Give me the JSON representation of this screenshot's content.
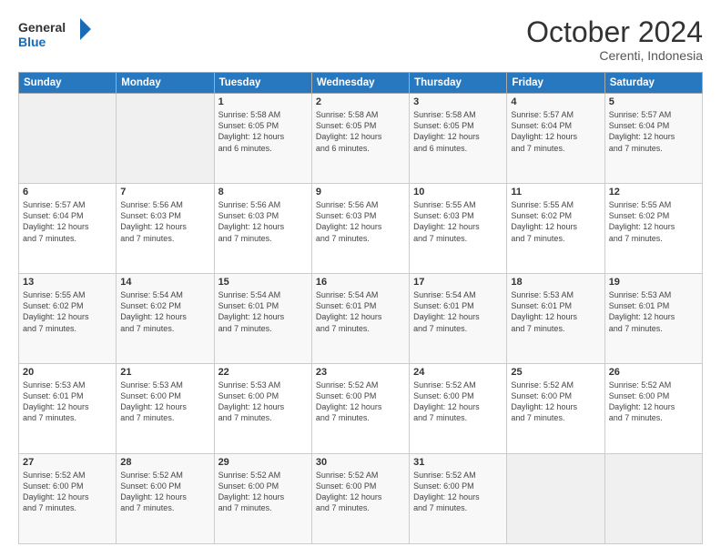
{
  "logo": {
    "line1": "General",
    "line2": "Blue"
  },
  "title": "October 2024",
  "subtitle": "Cerenti, Indonesia",
  "header_days": [
    "Sunday",
    "Monday",
    "Tuesday",
    "Wednesday",
    "Thursday",
    "Friday",
    "Saturday"
  ],
  "weeks": [
    [
      {
        "day": "",
        "info": ""
      },
      {
        "day": "",
        "info": ""
      },
      {
        "day": "1",
        "info": "Sunrise: 5:58 AM\nSunset: 6:05 PM\nDaylight: 12 hours\nand 6 minutes."
      },
      {
        "day": "2",
        "info": "Sunrise: 5:58 AM\nSunset: 6:05 PM\nDaylight: 12 hours\nand 6 minutes."
      },
      {
        "day": "3",
        "info": "Sunrise: 5:58 AM\nSunset: 6:05 PM\nDaylight: 12 hours\nand 6 minutes."
      },
      {
        "day": "4",
        "info": "Sunrise: 5:57 AM\nSunset: 6:04 PM\nDaylight: 12 hours\nand 7 minutes."
      },
      {
        "day": "5",
        "info": "Sunrise: 5:57 AM\nSunset: 6:04 PM\nDaylight: 12 hours\nand 7 minutes."
      }
    ],
    [
      {
        "day": "6",
        "info": "Sunrise: 5:57 AM\nSunset: 6:04 PM\nDaylight: 12 hours\nand 7 minutes."
      },
      {
        "day": "7",
        "info": "Sunrise: 5:56 AM\nSunset: 6:03 PM\nDaylight: 12 hours\nand 7 minutes."
      },
      {
        "day": "8",
        "info": "Sunrise: 5:56 AM\nSunset: 6:03 PM\nDaylight: 12 hours\nand 7 minutes."
      },
      {
        "day": "9",
        "info": "Sunrise: 5:56 AM\nSunset: 6:03 PM\nDaylight: 12 hours\nand 7 minutes."
      },
      {
        "day": "10",
        "info": "Sunrise: 5:55 AM\nSunset: 6:03 PM\nDaylight: 12 hours\nand 7 minutes."
      },
      {
        "day": "11",
        "info": "Sunrise: 5:55 AM\nSunset: 6:02 PM\nDaylight: 12 hours\nand 7 minutes."
      },
      {
        "day": "12",
        "info": "Sunrise: 5:55 AM\nSunset: 6:02 PM\nDaylight: 12 hours\nand 7 minutes."
      }
    ],
    [
      {
        "day": "13",
        "info": "Sunrise: 5:55 AM\nSunset: 6:02 PM\nDaylight: 12 hours\nand 7 minutes."
      },
      {
        "day": "14",
        "info": "Sunrise: 5:54 AM\nSunset: 6:02 PM\nDaylight: 12 hours\nand 7 minutes."
      },
      {
        "day": "15",
        "info": "Sunrise: 5:54 AM\nSunset: 6:01 PM\nDaylight: 12 hours\nand 7 minutes."
      },
      {
        "day": "16",
        "info": "Sunrise: 5:54 AM\nSunset: 6:01 PM\nDaylight: 12 hours\nand 7 minutes."
      },
      {
        "day": "17",
        "info": "Sunrise: 5:54 AM\nSunset: 6:01 PM\nDaylight: 12 hours\nand 7 minutes."
      },
      {
        "day": "18",
        "info": "Sunrise: 5:53 AM\nSunset: 6:01 PM\nDaylight: 12 hours\nand 7 minutes."
      },
      {
        "day": "19",
        "info": "Sunrise: 5:53 AM\nSunset: 6:01 PM\nDaylight: 12 hours\nand 7 minutes."
      }
    ],
    [
      {
        "day": "20",
        "info": "Sunrise: 5:53 AM\nSunset: 6:01 PM\nDaylight: 12 hours\nand 7 minutes."
      },
      {
        "day": "21",
        "info": "Sunrise: 5:53 AM\nSunset: 6:00 PM\nDaylight: 12 hours\nand 7 minutes."
      },
      {
        "day": "22",
        "info": "Sunrise: 5:53 AM\nSunset: 6:00 PM\nDaylight: 12 hours\nand 7 minutes."
      },
      {
        "day": "23",
        "info": "Sunrise: 5:52 AM\nSunset: 6:00 PM\nDaylight: 12 hours\nand 7 minutes."
      },
      {
        "day": "24",
        "info": "Sunrise: 5:52 AM\nSunset: 6:00 PM\nDaylight: 12 hours\nand 7 minutes."
      },
      {
        "day": "25",
        "info": "Sunrise: 5:52 AM\nSunset: 6:00 PM\nDaylight: 12 hours\nand 7 minutes."
      },
      {
        "day": "26",
        "info": "Sunrise: 5:52 AM\nSunset: 6:00 PM\nDaylight: 12 hours\nand 7 minutes."
      }
    ],
    [
      {
        "day": "27",
        "info": "Sunrise: 5:52 AM\nSunset: 6:00 PM\nDaylight: 12 hours\nand 7 minutes."
      },
      {
        "day": "28",
        "info": "Sunrise: 5:52 AM\nSunset: 6:00 PM\nDaylight: 12 hours\nand 7 minutes."
      },
      {
        "day": "29",
        "info": "Sunrise: 5:52 AM\nSunset: 6:00 PM\nDaylight: 12 hours\nand 7 minutes."
      },
      {
        "day": "30",
        "info": "Sunrise: 5:52 AM\nSunset: 6:00 PM\nDaylight: 12 hours\nand 7 minutes."
      },
      {
        "day": "31",
        "info": "Sunrise: 5:52 AM\nSunset: 6:00 PM\nDaylight: 12 hours\nand 7 minutes."
      },
      {
        "day": "",
        "info": ""
      },
      {
        "day": "",
        "info": ""
      }
    ]
  ]
}
